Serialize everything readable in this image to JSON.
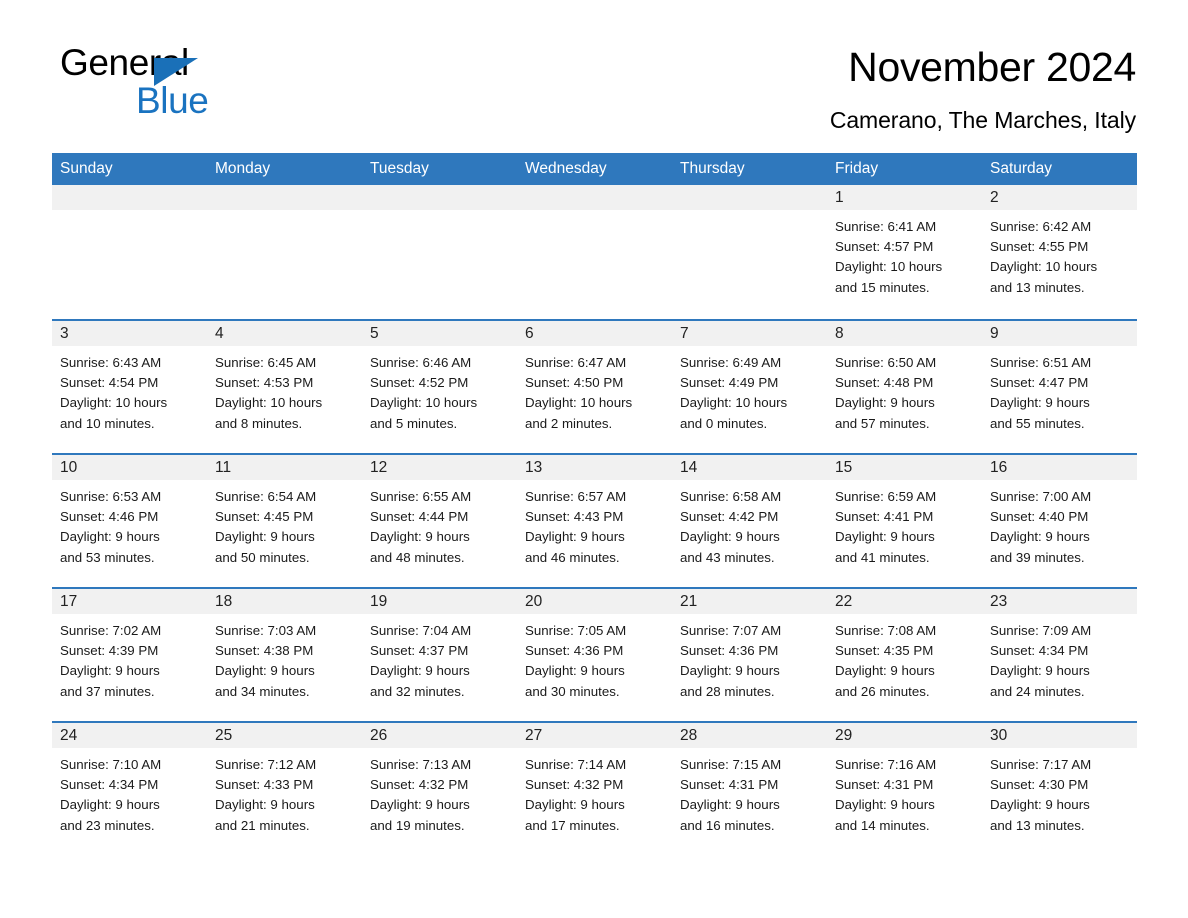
{
  "brand": {
    "name_part1": "General",
    "name_part2": "Blue",
    "accent_color": "#1a73c0"
  },
  "header": {
    "month_title": "November 2024",
    "location": "Camerano, The Marches, Italy"
  },
  "calendar": {
    "header_color": "#2f78bd",
    "daynum_bar_color": "#f1f1f1",
    "weekday_headers": [
      "Sunday",
      "Monday",
      "Tuesday",
      "Wednesday",
      "Thursday",
      "Friday",
      "Saturday"
    ],
    "weeks": [
      [
        {
          "day": "",
          "sunrise": "",
          "sunset": "",
          "daylight_line1": "",
          "daylight_line2": ""
        },
        {
          "day": "",
          "sunrise": "",
          "sunset": "",
          "daylight_line1": "",
          "daylight_line2": ""
        },
        {
          "day": "",
          "sunrise": "",
          "sunset": "",
          "daylight_line1": "",
          "daylight_line2": ""
        },
        {
          "day": "",
          "sunrise": "",
          "sunset": "",
          "daylight_line1": "",
          "daylight_line2": ""
        },
        {
          "day": "",
          "sunrise": "",
          "sunset": "",
          "daylight_line1": "",
          "daylight_line2": ""
        },
        {
          "day": "1",
          "sunrise": "Sunrise: 6:41 AM",
          "sunset": "Sunset: 4:57 PM",
          "daylight_line1": "Daylight: 10 hours",
          "daylight_line2": "and 15 minutes."
        },
        {
          "day": "2",
          "sunrise": "Sunrise: 6:42 AM",
          "sunset": "Sunset: 4:55 PM",
          "daylight_line1": "Daylight: 10 hours",
          "daylight_line2": "and 13 minutes."
        }
      ],
      [
        {
          "day": "3",
          "sunrise": "Sunrise: 6:43 AM",
          "sunset": "Sunset: 4:54 PM",
          "daylight_line1": "Daylight: 10 hours",
          "daylight_line2": "and 10 minutes."
        },
        {
          "day": "4",
          "sunrise": "Sunrise: 6:45 AM",
          "sunset": "Sunset: 4:53 PM",
          "daylight_line1": "Daylight: 10 hours",
          "daylight_line2": "and 8 minutes."
        },
        {
          "day": "5",
          "sunrise": "Sunrise: 6:46 AM",
          "sunset": "Sunset: 4:52 PM",
          "daylight_line1": "Daylight: 10 hours",
          "daylight_line2": "and 5 minutes."
        },
        {
          "day": "6",
          "sunrise": "Sunrise: 6:47 AM",
          "sunset": "Sunset: 4:50 PM",
          "daylight_line1": "Daylight: 10 hours",
          "daylight_line2": "and 2 minutes."
        },
        {
          "day": "7",
          "sunrise": "Sunrise: 6:49 AM",
          "sunset": "Sunset: 4:49 PM",
          "daylight_line1": "Daylight: 10 hours",
          "daylight_line2": "and 0 minutes."
        },
        {
          "day": "8",
          "sunrise": "Sunrise: 6:50 AM",
          "sunset": "Sunset: 4:48 PM",
          "daylight_line1": "Daylight: 9 hours",
          "daylight_line2": "and 57 minutes."
        },
        {
          "day": "9",
          "sunrise": "Sunrise: 6:51 AM",
          "sunset": "Sunset: 4:47 PM",
          "daylight_line1": "Daylight: 9 hours",
          "daylight_line2": "and 55 minutes."
        }
      ],
      [
        {
          "day": "10",
          "sunrise": "Sunrise: 6:53 AM",
          "sunset": "Sunset: 4:46 PM",
          "daylight_line1": "Daylight: 9 hours",
          "daylight_line2": "and 53 minutes."
        },
        {
          "day": "11",
          "sunrise": "Sunrise: 6:54 AM",
          "sunset": "Sunset: 4:45 PM",
          "daylight_line1": "Daylight: 9 hours",
          "daylight_line2": "and 50 minutes."
        },
        {
          "day": "12",
          "sunrise": "Sunrise: 6:55 AM",
          "sunset": "Sunset: 4:44 PM",
          "daylight_line1": "Daylight: 9 hours",
          "daylight_line2": "and 48 minutes."
        },
        {
          "day": "13",
          "sunrise": "Sunrise: 6:57 AM",
          "sunset": "Sunset: 4:43 PM",
          "daylight_line1": "Daylight: 9 hours",
          "daylight_line2": "and 46 minutes."
        },
        {
          "day": "14",
          "sunrise": "Sunrise: 6:58 AM",
          "sunset": "Sunset: 4:42 PM",
          "daylight_line1": "Daylight: 9 hours",
          "daylight_line2": "and 43 minutes."
        },
        {
          "day": "15",
          "sunrise": "Sunrise: 6:59 AM",
          "sunset": "Sunset: 4:41 PM",
          "daylight_line1": "Daylight: 9 hours",
          "daylight_line2": "and 41 minutes."
        },
        {
          "day": "16",
          "sunrise": "Sunrise: 7:00 AM",
          "sunset": "Sunset: 4:40 PM",
          "daylight_line1": "Daylight: 9 hours",
          "daylight_line2": "and 39 minutes."
        }
      ],
      [
        {
          "day": "17",
          "sunrise": "Sunrise: 7:02 AM",
          "sunset": "Sunset: 4:39 PM",
          "daylight_line1": "Daylight: 9 hours",
          "daylight_line2": "and 37 minutes."
        },
        {
          "day": "18",
          "sunrise": "Sunrise: 7:03 AM",
          "sunset": "Sunset: 4:38 PM",
          "daylight_line1": "Daylight: 9 hours",
          "daylight_line2": "and 34 minutes."
        },
        {
          "day": "19",
          "sunrise": "Sunrise: 7:04 AM",
          "sunset": "Sunset: 4:37 PM",
          "daylight_line1": "Daylight: 9 hours",
          "daylight_line2": "and 32 minutes."
        },
        {
          "day": "20",
          "sunrise": "Sunrise: 7:05 AM",
          "sunset": "Sunset: 4:36 PM",
          "daylight_line1": "Daylight: 9 hours",
          "daylight_line2": "and 30 minutes."
        },
        {
          "day": "21",
          "sunrise": "Sunrise: 7:07 AM",
          "sunset": "Sunset: 4:36 PM",
          "daylight_line1": "Daylight: 9 hours",
          "daylight_line2": "and 28 minutes."
        },
        {
          "day": "22",
          "sunrise": "Sunrise: 7:08 AM",
          "sunset": "Sunset: 4:35 PM",
          "daylight_line1": "Daylight: 9 hours",
          "daylight_line2": "and 26 minutes."
        },
        {
          "day": "23",
          "sunrise": "Sunrise: 7:09 AM",
          "sunset": "Sunset: 4:34 PM",
          "daylight_line1": "Daylight: 9 hours",
          "daylight_line2": "and 24 minutes."
        }
      ],
      [
        {
          "day": "24",
          "sunrise": "Sunrise: 7:10 AM",
          "sunset": "Sunset: 4:34 PM",
          "daylight_line1": "Daylight: 9 hours",
          "daylight_line2": "and 23 minutes."
        },
        {
          "day": "25",
          "sunrise": "Sunrise: 7:12 AM",
          "sunset": "Sunset: 4:33 PM",
          "daylight_line1": "Daylight: 9 hours",
          "daylight_line2": "and 21 minutes."
        },
        {
          "day": "26",
          "sunrise": "Sunrise: 7:13 AM",
          "sunset": "Sunset: 4:32 PM",
          "daylight_line1": "Daylight: 9 hours",
          "daylight_line2": "and 19 minutes."
        },
        {
          "day": "27",
          "sunrise": "Sunrise: 7:14 AM",
          "sunset": "Sunset: 4:32 PM",
          "daylight_line1": "Daylight: 9 hours",
          "daylight_line2": "and 17 minutes."
        },
        {
          "day": "28",
          "sunrise": "Sunrise: 7:15 AM",
          "sunset": "Sunset: 4:31 PM",
          "daylight_line1": "Daylight: 9 hours",
          "daylight_line2": "and 16 minutes."
        },
        {
          "day": "29",
          "sunrise": "Sunrise: 7:16 AM",
          "sunset": "Sunset: 4:31 PM",
          "daylight_line1": "Daylight: 9 hours",
          "daylight_line2": "and 14 minutes."
        },
        {
          "day": "30",
          "sunrise": "Sunrise: 7:17 AM",
          "sunset": "Sunset: 4:30 PM",
          "daylight_line1": "Daylight: 9 hours",
          "daylight_line2": "and 13 minutes."
        }
      ]
    ]
  }
}
